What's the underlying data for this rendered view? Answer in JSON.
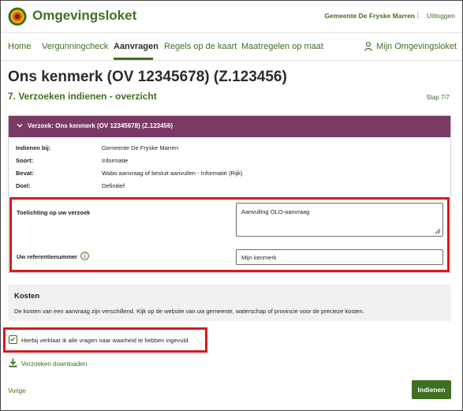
{
  "app": {
    "name": "Omgevingsloket",
    "municipality": "Gemeente De Fryske Marren",
    "separator": "|",
    "logout": "Uitloggen"
  },
  "nav": {
    "items": [
      {
        "label": "Home"
      },
      {
        "label": "Vergunningcheck"
      },
      {
        "label": "Aanvragen"
      },
      {
        "label": "Regels op de kaart"
      },
      {
        "label": "Maatregelen op maat"
      }
    ],
    "active": "Aanvragen",
    "account": "Mijn Omgevingsloket"
  },
  "page": {
    "title": "Ons kenmerk (OV 12345678) (Z.123456)",
    "step_title": "7. Verzoeken indienen - overzicht",
    "step_count": "Stap 7/7"
  },
  "request": {
    "header": "Verzoek: Ons kenmerk (OV 12345678) (Z.123456)",
    "fields": [
      {
        "label": "Indienen bij:",
        "value": "Gemeente De Fryske Marren"
      },
      {
        "label": "Soort:",
        "value": "Informatie"
      },
      {
        "label": "Bevat:",
        "value": "Wabo aanvraag of besluit aanvullen - Informatie (Rijk)"
      },
      {
        "label": "Doel:",
        "value": "Definitief"
      }
    ],
    "explanation_label": "Toelichting op uw verzoek",
    "explanation_value": "Aanvulling OLO-aanvraag",
    "reference_label": "Uw referentienummer",
    "reference_value": "Mijn kenmerk"
  },
  "costs": {
    "heading": "Kosten",
    "text": "De kosten van een aanvraag zijn verschillend. Kijk op de website van uw gemeente, waterschap of provincie voor de precieze kosten."
  },
  "declaration": {
    "label": "Hierbij verklaar ik alle vragen naar waarheid te hebben ingevuld.",
    "checked": true
  },
  "download_label": "Verzoeken downloaden",
  "footer": {
    "prev_label": "Vorige",
    "submit_label": "Indienen"
  },
  "colors": {
    "brand_green": "#3f6f21",
    "panel_header": "#7a3a66",
    "highlight_red": "#d71920"
  }
}
